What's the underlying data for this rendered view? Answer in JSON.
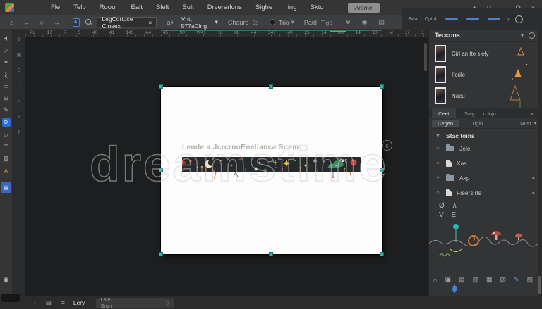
{
  "colors": {
    "accent_teal": "#35b5a8",
    "accent_blue": "#4a7fd4",
    "artboard": "#fdfdfd",
    "banner_bg": "#282b2d"
  },
  "titlebar": {
    "menu": [
      "Fle",
      "Telp",
      "Roour",
      "Ealt",
      "Slelt",
      "Sult",
      "Drverarlons",
      "Sighe",
      "Iing",
      "Skto"
    ],
    "arome": "Arome",
    "controls": {
      "move": "+",
      "restore": "□",
      "min": "–",
      "zero": "O",
      "close": "×"
    }
  },
  "options": {
    "home": "⌂",
    "back": "←",
    "sync": "○",
    "fwd": "→",
    "logo": "Ai",
    "tab": "LegCortoce Cineex",
    "tab_close": "×",
    "aplus": "a+",
    "doc": "Vntt 577aClng",
    "chevron": "▾",
    "chaure": "Chaure",
    "chaure_val": "2s",
    "trio": "Trio",
    "paid": "Paid",
    "tigo": "Tigo",
    "icons": {
      "snap": "⊕",
      "globe": "◉",
      "grid": "▤",
      "more": "⋮"
    }
  },
  "ministrip": {
    "swat": "Swat",
    "opt": "Opt 4",
    "arrow": "›"
  },
  "ruler": {
    "labels": [
      "PL",
      "17",
      "7",
      "5",
      "40",
      "41",
      "143",
      "A4",
      "45",
      "90",
      "W41",
      "10",
      "80",
      "44",
      "347",
      "40",
      "25",
      "14",
      "A0",
      "14",
      "10",
      "M",
      "17",
      "1"
    ]
  },
  "tools": {
    "list": [
      "➤",
      "▷",
      "∗",
      "ξ",
      "▭",
      "⊞",
      "✎",
      "▱",
      "T",
      "▥",
      "A"
    ],
    "selected": "▤",
    "bottom": "▣",
    "strip2": [
      "⊕",
      "▣",
      "C",
      "·",
      "N",
      "+",
      "ƒ"
    ]
  },
  "canvas": {
    "caption": "Lende a JcrcrnoEnellanca Snem",
    "watermark": "dreamstime",
    "copyright": "c"
  },
  "panel": {
    "teccons": {
      "title": "Teccons",
      "chev": "▾",
      "items": [
        "Cirl an tte slely",
        "Ifcrile",
        "Nacu"
      ]
    },
    "tabs": {
      "a": "Ceet",
      "b": "Salg",
      "c": "u lojn",
      "close": "×"
    },
    "fields": {
      "a": "Cegen",
      "b": "1 Tigln",
      "c": "Nust",
      "chev": "▾"
    },
    "tree": {
      "chev": "▾",
      "header": "Stac toins",
      "rows": [
        {
          "t": "○",
          "label": "Jele",
          "more": ""
        },
        {
          "t": "○",
          "label": "Xas",
          "more": ""
        },
        {
          "t": "▾",
          "label": "Akp",
          "more": "▸"
        },
        {
          "t": "○",
          "label": "Fieersirts",
          "more": "▸"
        }
      ]
    },
    "scribble": {
      "l1": "Ø ∧",
      "l2": "V E"
    },
    "dock": [
      "⌂",
      "▣",
      "▤",
      "▥",
      "▦",
      "▧",
      "✎",
      "▨"
    ]
  },
  "status": {
    "back": "‹",
    "i1": "▤",
    "i2": "≡",
    "label": "Lery",
    "field": "Laie Srgn",
    "circle": "○"
  }
}
